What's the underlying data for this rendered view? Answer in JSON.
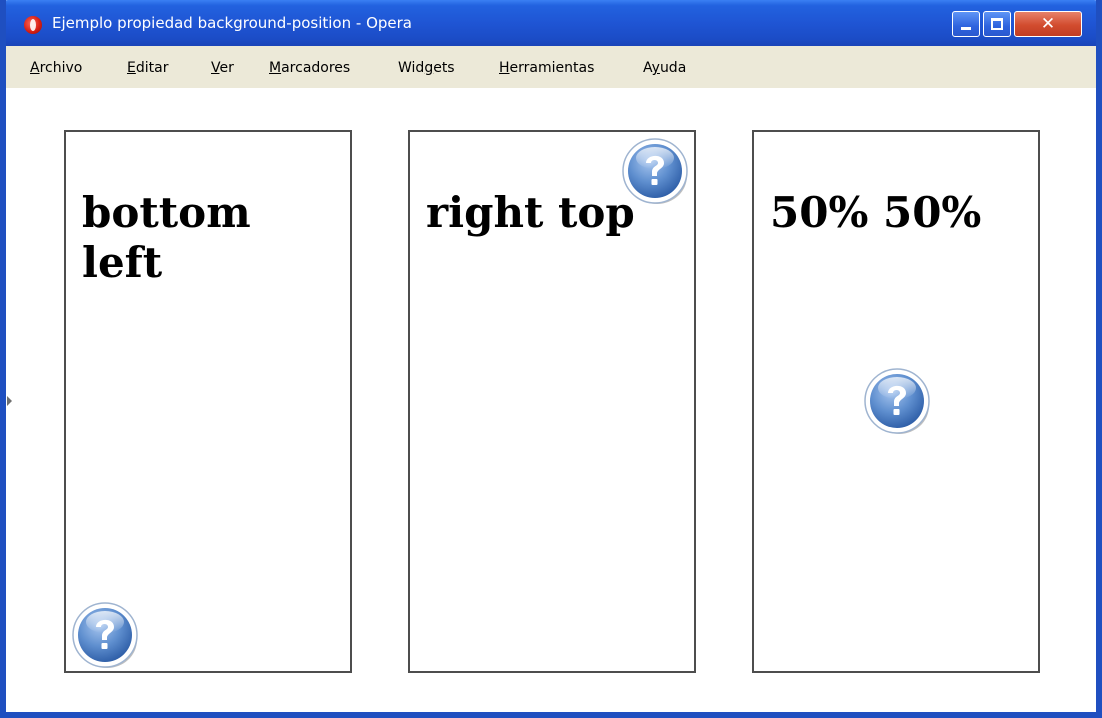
{
  "window": {
    "title": "Ejemplo propiedad background-position - Opera"
  },
  "menu": {
    "items": [
      {
        "before": "",
        "underline": "A",
        "after": "rchivo"
      },
      {
        "before": "",
        "underline": "E",
        "after": "ditar"
      },
      {
        "before": "",
        "underline": "V",
        "after": "er"
      },
      {
        "before": "",
        "underline": "M",
        "after": "arcadores"
      },
      {
        "before": "Wid",
        "underline": "g",
        "after": "ets"
      },
      {
        "before": "",
        "underline": "H",
        "after": "erramientas"
      },
      {
        "before": "A",
        "underline": "y",
        "after": "uda"
      }
    ]
  },
  "boxes": [
    {
      "label": "bottom left",
      "icon": "help-icon"
    },
    {
      "label": "right top",
      "icon": "help-icon"
    },
    {
      "label": "50% 50%",
      "icon": "help-icon"
    }
  ],
  "icons": {
    "app": "opera-icon",
    "minimize": "minimize-icon",
    "maximize": "maximize-icon",
    "close": "close-icon",
    "help": "help-icon"
  },
  "colors": {
    "titlebar": "#1f55d4",
    "menubar": "#ece9d8",
    "box_border": "#4d4d4d",
    "help_icon": "#3f6fae"
  }
}
